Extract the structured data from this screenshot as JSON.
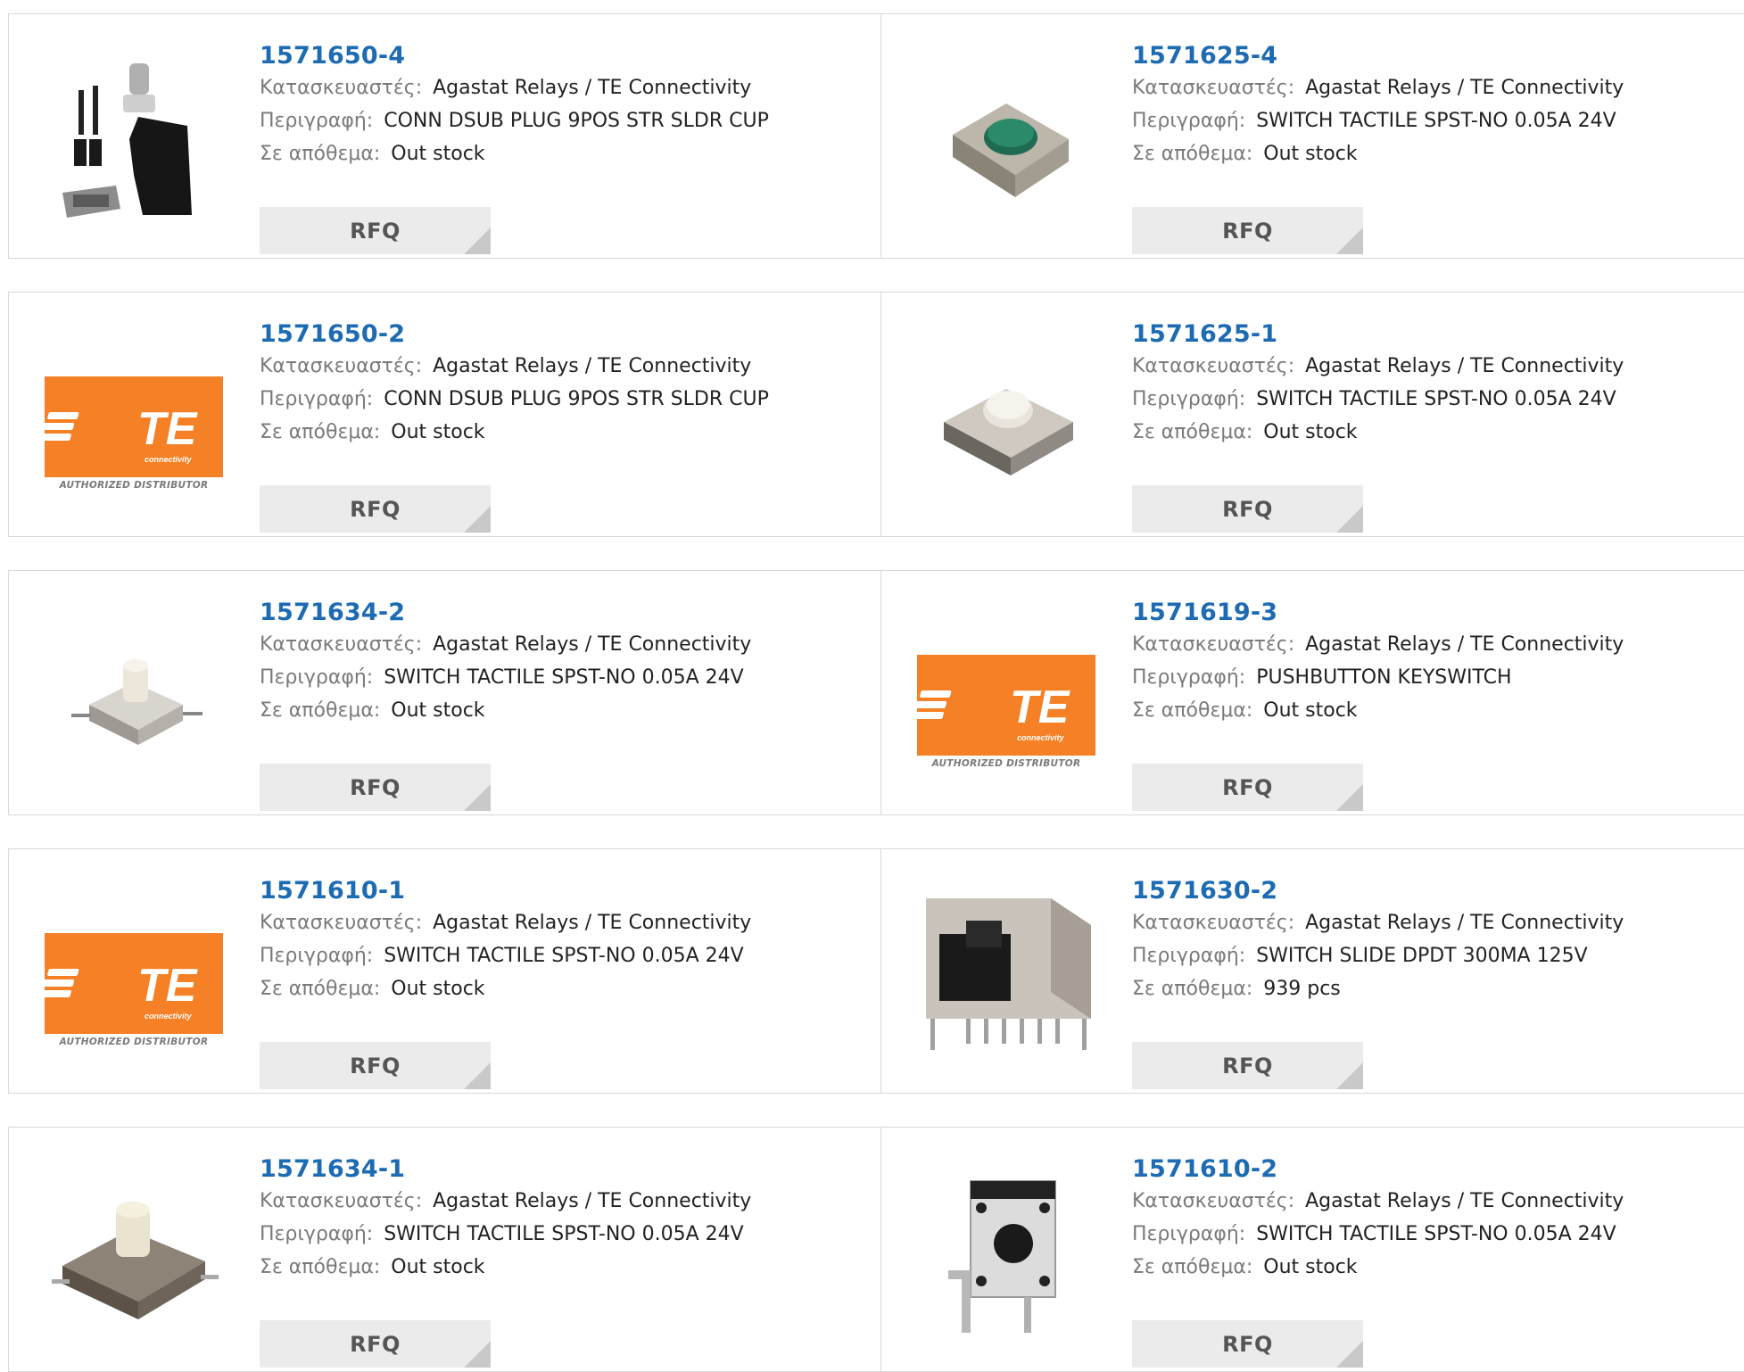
{
  "labels": {
    "manufacturer": "Κατασκευαστές:",
    "description": "Περιγραφή:",
    "stock": "Σε απόθεμα:",
    "rfq": "RFQ"
  },
  "te_logo": {
    "text": "TE",
    "sub": "connectivity",
    "distributor": "AUTHORIZED DISTRIBUTOR",
    "color": "#f58025"
  },
  "products": [
    {
      "part": "1571650-4",
      "manufacturer": "Agastat Relays / TE Connectivity",
      "description": "CONN DSUB PLUG 9POS STR SLDR CUP",
      "stock": "Out stock",
      "image": "dsub-connector-kit"
    },
    {
      "part": "1571625-4",
      "manufacturer": "Agastat Relays / TE Connectivity",
      "description": "SWITCH TACTILE SPST-NO 0.05A 24V",
      "stock": "Out stock",
      "image": "tactile-switch-green"
    },
    {
      "part": "1571650-2",
      "manufacturer": "Agastat Relays / TE Connectivity",
      "description": "CONN DSUB PLUG 9POS STR SLDR CUP",
      "stock": "Out stock",
      "image": "te-logo"
    },
    {
      "part": "1571625-1",
      "manufacturer": "Agastat Relays / TE Connectivity",
      "description": "SWITCH TACTILE SPST-NO 0.05A 24V",
      "stock": "Out stock",
      "image": "tactile-switch-white"
    },
    {
      "part": "1571634-2",
      "manufacturer": "Agastat Relays / TE Connectivity",
      "description": "SWITCH TACTILE SPST-NO 0.05A 24V",
      "stock": "Out stock",
      "image": "tactile-switch-tall"
    },
    {
      "part": "1571619-3",
      "manufacturer": "Agastat Relays / TE Connectivity",
      "description": "PUSHBUTTON KEYSWITCH",
      "stock": "Out stock",
      "image": "te-logo"
    },
    {
      "part": "1571610-1",
      "manufacturer": "Agastat Relays / TE Connectivity",
      "description": "SWITCH TACTILE SPST-NO 0.05A 24V",
      "stock": "Out stock",
      "image": "te-logo"
    },
    {
      "part": "1571630-2",
      "manufacturer": "Agastat Relays / TE Connectivity",
      "description": "SWITCH SLIDE DPDT 300MA 125V",
      "stock": "939 pcs",
      "image": "slide-switch"
    },
    {
      "part": "1571634-1",
      "manufacturer": "Agastat Relays / TE Connectivity",
      "description": "SWITCH TACTILE SPST-NO 0.05A 24V",
      "stock": "Out stock",
      "image": "tactile-switch-brown"
    },
    {
      "part": "1571610-2",
      "manufacturer": "Agastat Relays / TE Connectivity",
      "description": "SWITCH TACTILE SPST-NO 0.05A 24V",
      "stock": "Out stock",
      "image": "tactile-switch-right-angle"
    }
  ]
}
